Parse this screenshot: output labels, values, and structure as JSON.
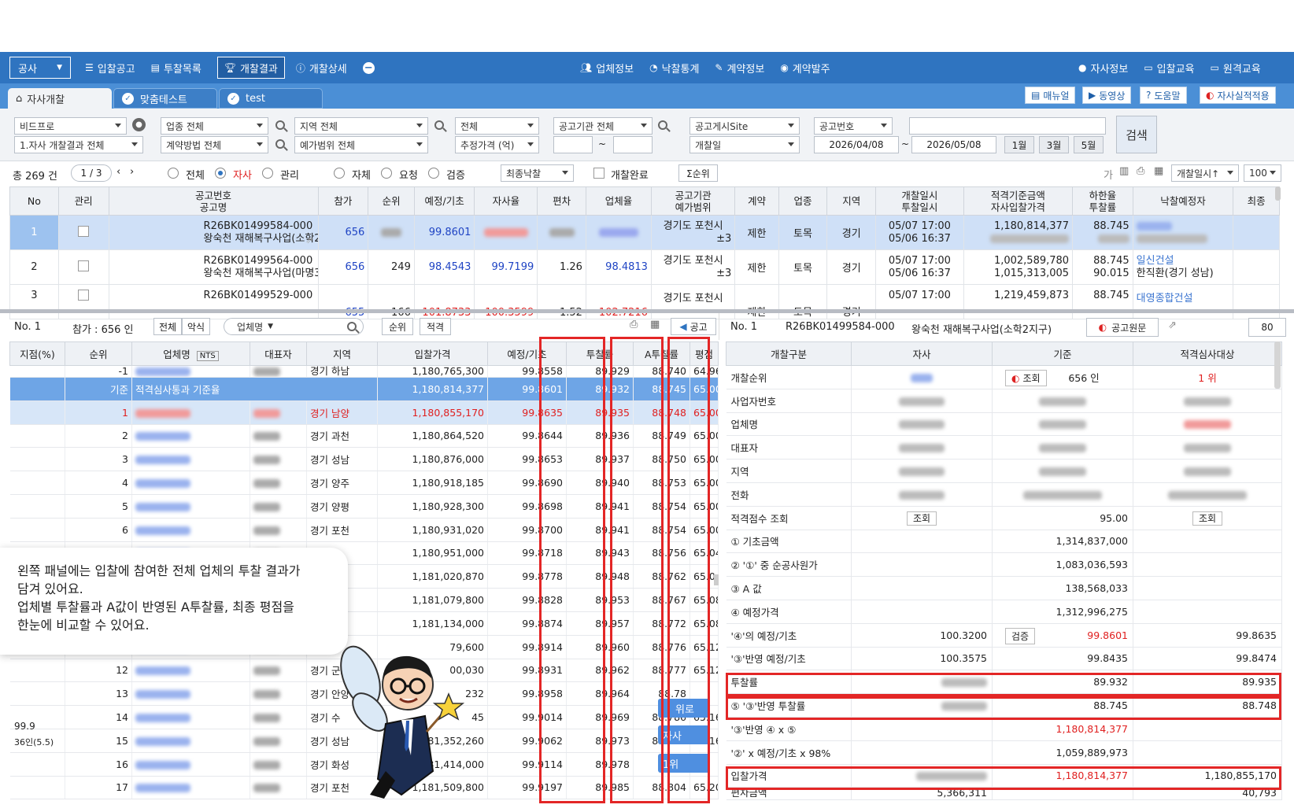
{
  "nav": {
    "left_select": "공사",
    "items": [
      "입찰공고",
      "투찰목록",
      "개찰결과",
      "개찰상세"
    ],
    "center": [
      "업체정보",
      "낙찰통계",
      "계약정보",
      "계약발주"
    ],
    "right": [
      "자사정보",
      "입찰교육",
      "원격교육"
    ]
  },
  "tabs": {
    "t1": "자사개찰",
    "t2": "맞춤테스트",
    "t3": "test",
    "r1": "매뉴얼",
    "r2": "동영상",
    "r3": "도움말",
    "r4": "자사실적적용"
  },
  "filters": {
    "f1": "비드프로",
    "f2": "1.자사 개찰결과 전체",
    "f3": "업종 전체",
    "f4": "계약방법 전체",
    "f5": "지역 전체",
    "f6": "예가범위 전체",
    "f7": "전체",
    "f8": "추정가격 (억)",
    "f9": "공고기관 전체",
    "f10": "공고게시Site",
    "f11": "개찰일",
    "f12": "공고번호",
    "date1": "2026/04/08",
    "date2": "2026/05/08",
    "tilde1": "~",
    "tilde2": "~",
    "b1": "1월",
    "b2": "3월",
    "b3": "5월",
    "search": "검색"
  },
  "opts": {
    "total": "총 269 건",
    "page": "1 / 3",
    "r1": "전체",
    "r2": "자사",
    "r3": "관리",
    "r4": "자체",
    "r5": "요청",
    "r6": "검증",
    "sort": "최종낙찰",
    "done": "개찰완료",
    "sigma": "Σ순위",
    "ga": "가",
    "order": "개찰일시↑",
    "per": "100"
  },
  "main_headers": [
    "No",
    "관리",
    "공고번호\n공고명",
    "참가",
    "순위",
    "예정/기초",
    "자사율",
    "편차",
    "업체율",
    "공고기관\n예가범위",
    "계약",
    "업종",
    "지역",
    "개찰일시\n투찰일시",
    "적격기준금액\n자사입찰가격",
    "하한율\n투찰률",
    "낙찰예정자",
    "최종"
  ],
  "main_rows": [
    {
      "no": "1",
      "id": "R26BK01499584-000",
      "name": "왕숙천 재해복구사업(소학2지구)",
      "p": "656",
      "rank": "",
      "ratio": "99.8601",
      "org": "경기도 포천시",
      "range": "±3",
      "k": "제한",
      "ind": "토목",
      "reg": "경기",
      "d1": "05/07 17:00",
      "d2": "05/06 16:37",
      "a1": "1,180,814,377",
      "a2": "",
      "l1": "88.745",
      "l2": "",
      "w1": "",
      "w2": ""
    },
    {
      "no": "2",
      "id": "R26BK01499564-000",
      "name": "왕숙천 재해복구사업(마명3지구)",
      "p": "656",
      "rank": "249",
      "ratio": "98.4543",
      "self": "99.7199",
      "dev": "1.26",
      "firm": "98.4813",
      "org": "경기도 포천시",
      "range": "±3",
      "k": "제한",
      "ind": "토목",
      "reg": "경기",
      "d1": "05/07 17:00",
      "d2": "05/06 16:37",
      "a1": "1,002,589,780",
      "a2": "1,015,313,005",
      "l1": "88.745",
      "l2": "90.015",
      "w1": "일신건설",
      "w2": "한직환(경기 성남)"
    },
    {
      "no": "3",
      "id": "R26BK01499529-000",
      "name": "",
      "p": "655",
      "rank": "-166",
      "ratio": "101.8733",
      "self": "100.3599",
      "dev": "-1.52",
      "firm": "102.7216",
      "org": "경기도 포천시",
      "k": "제한",
      "ind": "토목",
      "reg": "경기",
      "d1": "05/07 17:00",
      "a1": "1,219,459,873",
      "l1": "88.745",
      "w1": "대영종합건설"
    }
  ],
  "left": {
    "no": "No. 1",
    "join": "참가 : 656 인",
    "b1": "전체",
    "b2": "악식",
    "firmsel": "업체명",
    "b3": "순위",
    "b4": "적격",
    "notice": "공고",
    "headers": [
      "지점(%)",
      "순위",
      "업체명",
      "NTS",
      "대표자",
      "지역",
      "입찰가격",
      "예정/기초",
      "투찰률",
      "A투찰률",
      "평점"
    ],
    "base_label": "기준",
    "base_text": "적격심사통과 기준율",
    "base": {
      "price": "1,180,814,377",
      "ratio": "99.8601",
      "r": "89.932",
      "a": "88.745",
      "s": "65.00"
    },
    "rows": [
      {
        "rk": "-1",
        "reg": "경기 하남",
        "price": "1,180,765,300",
        "ratio": "99.8558",
        "r": "89.929",
        "a": "88.740",
        "s": "64.96"
      },
      {
        "rk": "1",
        "reg": "경기 남양",
        "price": "1,180,855,170",
        "ratio": "99.8635",
        "r": "89.935",
        "a": "88.748",
        "s": "65.00"
      },
      {
        "rk": "2",
        "reg": "경기 과천",
        "price": "1,180,864,520",
        "ratio": "99.8644",
        "r": "89.936",
        "a": "88.749",
        "s": "65.00"
      },
      {
        "rk": "3",
        "reg": "경기 성남",
        "price": "1,180,876,000",
        "ratio": "99.8653",
        "r": "89.937",
        "a": "88.750",
        "s": "65.00"
      },
      {
        "rk": "4",
        "reg": "경기 양주",
        "price": "1,180,918,185",
        "ratio": "99.8690",
        "r": "89.940",
        "a": "88.753",
        "s": "65.00"
      },
      {
        "rk": "5",
        "reg": "경기 양평",
        "price": "1,180,928,300",
        "ratio": "99.8698",
        "r": "89.941",
        "a": "88.754",
        "s": "65.00"
      },
      {
        "rk": "6",
        "reg": "경기 포천",
        "price": "1,180,931,020",
        "ratio": "99.8700",
        "r": "89.941",
        "a": "88.754",
        "s": "65.00"
      },
      {
        "rk": "",
        "reg": "",
        "price": "1,180,951,000",
        "ratio": "99.8718",
        "r": "89.943",
        "a": "88.756",
        "s": "65.04"
      },
      {
        "rk": "",
        "reg": "",
        "price": "1,181,020,870",
        "ratio": "99.8778",
        "r": "89.948",
        "a": "88.762",
        "s": "65.04"
      },
      {
        "rk": "",
        "reg": "",
        "price": "1,181,079,800",
        "ratio": "99.8828",
        "r": "89.953",
        "a": "88.767",
        "s": "65.08"
      },
      {
        "rk": "",
        "reg": "",
        "price": "1,181,134,000",
        "ratio": "99.8874",
        "r": "89.957",
        "a": "88.772",
        "s": "65.08"
      },
      {
        "rk": "",
        "reg": "",
        "price": "79,600",
        "ratio": "99.8914",
        "r": "89.960",
        "a": "88.776",
        "s": "65.12"
      },
      {
        "rk": "12",
        "reg": "경기 군포",
        "price": "00,030",
        "ratio": "99.8931",
        "r": "89.962",
        "a": "88.777",
        "s": "65.12"
      },
      {
        "rk": "13",
        "reg": "경기 안양",
        "price": "232",
        "ratio": "99.8958",
        "r": "89.964",
        "a": "88.78",
        "s": ""
      },
      {
        "rk": "14",
        "reg": "경기 수",
        "price": "45",
        "ratio": "99.9014",
        "r": "89.969",
        "a": "88.786",
        "s": "65.16"
      },
      {
        "rk": "15",
        "reg": "경기 성남",
        "price": "181,352,260",
        "ratio": "99.9062",
        "r": "89.973",
        "a": "88.790",
        "s": "65.16"
      },
      {
        "rk": "16",
        "reg": "경기 화성",
        "price": "1,181,414,000",
        "ratio": "99.9114",
        "r": "89.978",
        "a": "88.79",
        "s": ""
      },
      {
        "rk": "17",
        "reg": "경기 포천",
        "price": "1,181,509,800",
        "ratio": "99.9197",
        "r": "89.985",
        "a": "88.804",
        "s": "65.20"
      }
    ],
    "side1": "99.9",
    "side2": "36인(5.5)",
    "float1": "위로",
    "float2": "자사",
    "float3": "1위"
  },
  "right": {
    "no": "No. 1",
    "id": "R26BK01499584-000",
    "name": "왕숙천 재해복구사업(소학2지구)",
    "orig": "공고원문",
    "num": "80",
    "headers": [
      "개찰구분",
      "자사",
      "기준",
      "적격심사대상"
    ],
    "rows": [
      {
        "l": "개찰순위",
        "b": "656 인",
        "btn": "조회",
        "c": "1 위"
      },
      {
        "l": "사업자번호"
      },
      {
        "l": "업체명"
      },
      {
        "l": "대표자"
      },
      {
        "l": "지역"
      },
      {
        "l": "전화"
      },
      {
        "l": "적격점수 조회",
        "abtn": "조회",
        "b": "95.00",
        "cbtn": "조회"
      },
      {
        "l": "① 기초금액",
        "b": "1,314,837,000"
      },
      {
        "l": "② '①' 중 순공사원가",
        "b": "1,083,036,593"
      },
      {
        "l": "③ A 값",
        "b": "138,568,033"
      },
      {
        "l": "④ 예정가격",
        "b": "1,312,996,275"
      },
      {
        "l": "'④'의 예정/기초",
        "a": "100.3200",
        "btn": "검증",
        "b": "99.8601",
        "c": "99.8635"
      },
      {
        "l": "'③'반영 예정/기초",
        "a": "100.3575",
        "b": "99.8435",
        "c": "99.8474"
      },
      {
        "l": "투찰률",
        "b": "89.932",
        "c": "89.935"
      },
      {
        "l": "⑤ '③'반영 투찰률",
        "b": "88.745",
        "c": "88.748"
      },
      {
        "l": "'③'반영 ④ x ⑤",
        "b": "1,180,814,377"
      },
      {
        "l": "'②' x 예정/기초 x 98%",
        "b": "1,059,889,973"
      },
      {
        "l": "입찰가격",
        "b": "1,180,814,377",
        "c": "1,180,855,170"
      },
      {
        "l": "편차금액",
        "a": "5,366,311",
        "c": "40,793"
      }
    ]
  },
  "tooltip": {
    "l1": "왼쪽 패널에는 입찰에 참여한 전체 업체의 투찰 결과가",
    "l2": "담겨 있어요.",
    "l3": "업체별 투찰률과 A값이 반영된 A투찰률, 최종 평점을",
    "l4": "한눈에 비교할 수 있어요."
  }
}
